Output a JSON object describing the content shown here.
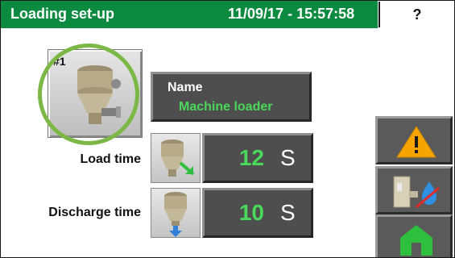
{
  "header": {
    "title": "Loading set-up",
    "datetime": "11/09/17 - 15:57:58",
    "help_label": "?",
    "background_color": "#0c8a3f"
  },
  "machine": {
    "number": "#1",
    "icon": "loader-hopper-icon",
    "highlight_color": "#7cb845"
  },
  "name_panel": {
    "label": "Name",
    "value": "Machine loader"
  },
  "load_time": {
    "label": "Load time",
    "value": "12",
    "unit": "S",
    "icon": "load-hopper-icon"
  },
  "discharge_time": {
    "label": "Discharge time",
    "value": "10",
    "unit": "S",
    "icon": "discharge-hopper-icon"
  },
  "side_buttons": [
    {
      "icon": "warning-icon"
    },
    {
      "icon": "dryer-no-water-icon"
    },
    {
      "icon": "home-icon"
    }
  ],
  "colors": {
    "value_text": "#49d85a",
    "panel": "#4e4e4e",
    "warning": "#f5a400",
    "home": "#2fbf3f"
  }
}
